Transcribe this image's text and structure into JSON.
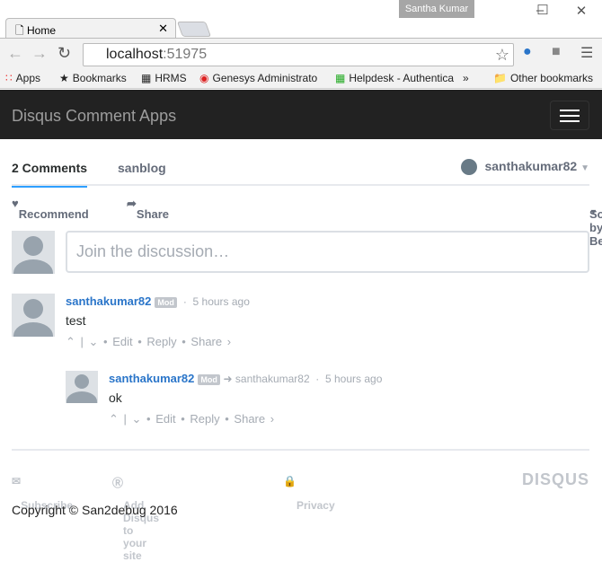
{
  "browser": {
    "user": "Santha Kumar",
    "tab_title": "Home",
    "url_host": "localhost",
    "url_port": ":51975",
    "bookmarks": [
      {
        "label": "Apps",
        "icon": "apps-icon"
      },
      {
        "label": "Bookmarks",
        "icon": "star-icon"
      },
      {
        "label": "HRMS",
        "icon": "hrms-icon"
      },
      {
        "label": "Genesys Administrato",
        "icon": "genesys-icon"
      },
      {
        "label": "Helpdesk - Authentica",
        "icon": "helpdesk-icon"
      },
      {
        "label": "»"
      },
      {
        "label": "Other bookmarks",
        "icon": "folder-icon"
      }
    ]
  },
  "app": {
    "title": "Disqus Comment Apps"
  },
  "disqus": {
    "tab_comments": "2 Comments",
    "tab_forum": "sanblog",
    "user": "santhakumar82",
    "recommend": "Recommend",
    "share": "Share",
    "sort": "Sort by Best",
    "placeholder": "Join the discussion…",
    "comments": [
      {
        "author": "santhakumar82",
        "badge": "Mod",
        "time": "5 hours ago",
        "text": "test",
        "edit": "Edit",
        "reply": "Reply",
        "share": "Share ›"
      },
      {
        "author": "santhakumar82",
        "badge": "Mod",
        "reply_to": "santhakumar82",
        "time": "5 hours ago",
        "text": "ok",
        "edit": "Edit",
        "reply": "Reply",
        "share": "Share ›"
      }
    ],
    "footer": {
      "subscribe": "Subscribe",
      "add": "Add Disqus to your site",
      "privacy": "Privacy",
      "logo": "DISQUS"
    }
  },
  "copyright": "Copyright © San2debug 2016"
}
